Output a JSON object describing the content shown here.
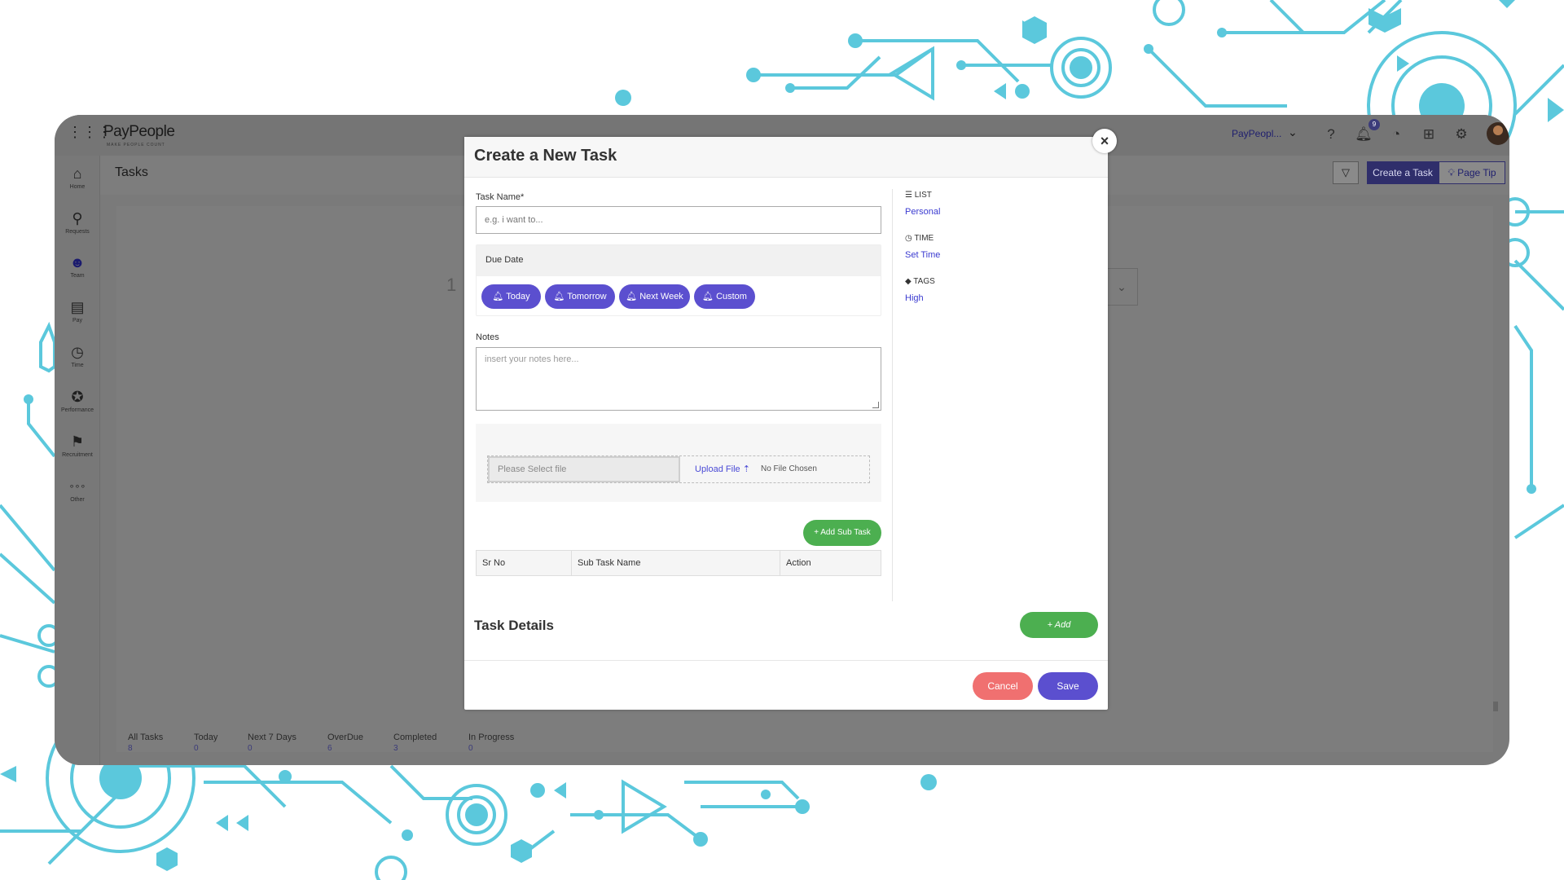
{
  "app": {
    "logo": "PayPeople",
    "logo_tagline": "MAKE PEOPLE COUNT",
    "company_select": "PayPeopl...",
    "notification_count": "9",
    "page_title": "Tasks",
    "create_task_label": "Create a Task",
    "page_tip_label": "Page Tip",
    "bg_number": "1"
  },
  "sidebar": {
    "items": [
      {
        "label": "Home",
        "icon": "home-icon",
        "glyph": "⌂"
      },
      {
        "label": "Requests",
        "icon": "requests-icon",
        "glyph": "⚲"
      },
      {
        "label": "Team",
        "icon": "team-icon",
        "glyph": "☻"
      },
      {
        "label": "Pay",
        "icon": "pay-icon",
        "glyph": "▤"
      },
      {
        "label": "Time",
        "icon": "time-icon",
        "glyph": "◷"
      },
      {
        "label": "Performance",
        "icon": "performance-icon",
        "glyph": "✪"
      },
      {
        "label": "Recruitment",
        "icon": "recruitment-icon",
        "glyph": "⚑"
      },
      {
        "label": "Other",
        "icon": "other-icon",
        "glyph": "∘∘∘"
      }
    ]
  },
  "stats": [
    {
      "label": "All Tasks",
      "value": "8"
    },
    {
      "label": "Today",
      "value": "0"
    },
    {
      "label": "Next 7 Days",
      "value": "0"
    },
    {
      "label": "OverDue",
      "value": "6"
    },
    {
      "label": "Completed",
      "value": "3"
    },
    {
      "label": "In Progress",
      "value": "0"
    }
  ],
  "modal": {
    "title": "Create a New Task",
    "task_name_label": "Task Name*",
    "task_name_placeholder": "e.g. i want to...",
    "due_date_label": "Due Date",
    "due_buttons": [
      "Today",
      "Tomorrow",
      "Next Week",
      "Custom"
    ],
    "notes_label": "Notes",
    "notes_placeholder": "insert your notes here...",
    "file_placeholder": "Please Select file",
    "upload_label": "Upload File",
    "no_file": "No File Chosen",
    "add_sub_task": "Add Sub Task",
    "table_headers": [
      "Sr No",
      "Sub Task Name",
      "Action"
    ],
    "list_label": "LIST",
    "list_value": "Personal",
    "time_label": "TIME",
    "time_value": "Set Time",
    "tags_label": "TAGS",
    "tags_value": "High",
    "task_details_title": "Task Details",
    "add_label": "+ Add",
    "cancel_label": "Cancel",
    "save_label": "Save"
  },
  "colors": {
    "primary": "#5b4fcf",
    "success": "#4caf50",
    "danger": "#f07070",
    "decor": "#5bc8dc"
  }
}
